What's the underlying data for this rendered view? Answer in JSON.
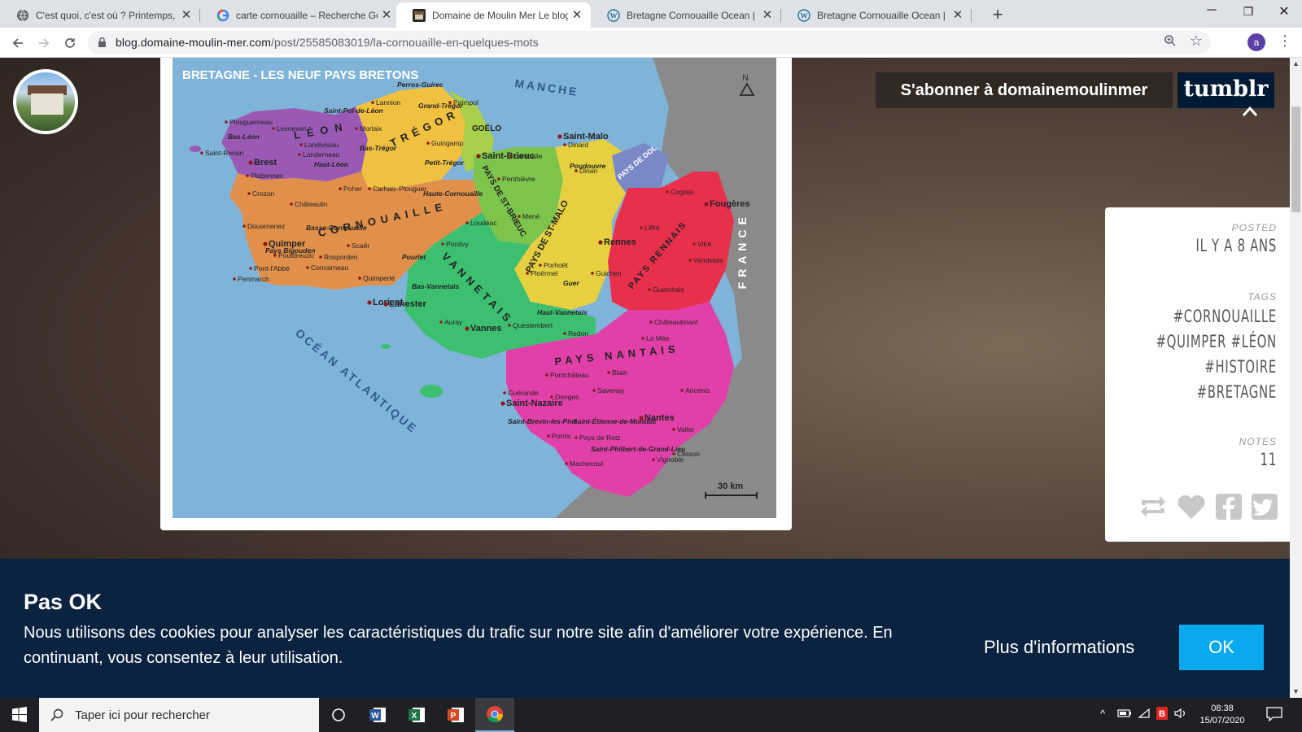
{
  "tabs": [
    {
      "title": "C'est quoi, c'est où ? Printemps, é",
      "active": false
    },
    {
      "title": "carte cornouaille – Recherche Go",
      "active": false
    },
    {
      "title": "Domaine de Moulin Mer Le blog",
      "active": true
    },
    {
      "title": "Bretagne Cornouaille Ocean | De",
      "active": false
    },
    {
      "title": "Bretagne Cornouaille Ocean | De",
      "active": false
    }
  ],
  "tab_close": "✕",
  "new_tab": "+",
  "window": {
    "minimize": "─",
    "restore": "❐",
    "close": "✕"
  },
  "address": {
    "domain": "blog.domaine-moulin-mer.com",
    "path": "/post/25585083019/la-cornouaille-en-quelques-mots"
  },
  "profile_initial": "a",
  "map": {
    "title": "BRETAGNE - LES NEUF PAYS BRETONS",
    "north": "N",
    "scale": "30 km",
    "sea_labels": {
      "manche": "MANCHE",
      "ocean": "OCÉAN ATLANTIQUE",
      "france": "FRANCE"
    },
    "pays": [
      {
        "name": "LÉON",
        "color": "#9b59b6"
      },
      {
        "name": "TRÉGOR",
        "color": "#f0c040"
      },
      {
        "name": "GOËLO",
        "color": "#a8d04a"
      },
      {
        "name": "PAYS DE ST-BRIEUC",
        "color": "#7cc44c"
      },
      {
        "name": "PAYS DE ST-MALO",
        "color": "#e6d040"
      },
      {
        "name": "PAYS DE DOL",
        "color": "#7a88c8"
      },
      {
        "name": "PAYS RENNAIS",
        "color": "#e8304c"
      },
      {
        "name": "CORNOUAILLE",
        "color": "#e0904a"
      },
      {
        "name": "VANNETAIS",
        "color": "#3cc070"
      },
      {
        "name": "PAYS NANTAIS",
        "color": "#e040a8"
      }
    ],
    "towns": [
      "Brest",
      "Quimper",
      "Lorient",
      "Lanester",
      "Vannes",
      "Rennes",
      "Saint-Brieuc",
      "Saint-Malo",
      "Saint-Nazaire",
      "Nantes",
      "Fougères",
      "Crozon",
      "Châteaulin",
      "Douarnenez",
      "Concarneau",
      "Pontivy",
      "Dinard",
      "Morlaix",
      "Lannion",
      "Paimpol",
      "Guingamp",
      "Dinan",
      "Ploërmel",
      "Redon",
      "Vitré",
      "Guérande",
      "Ancenis",
      "Vignoble",
      "Pays de Retz",
      "Plouguerneau",
      "Lesneven",
      "Landerneau",
      "Landivisiau",
      "Saint-Renan",
      "Quimperlé",
      "Pont-l'Abbé",
      "Penmarch",
      "Auray",
      "Questembert",
      "Guichen",
      "Lamballe",
      "Penthièvre",
      "Mené",
      "Porhoët",
      "Coglais",
      "Liffré",
      "Vendelais",
      "Guerchais",
      "Châteaubriant",
      "La Mée",
      "Blain",
      "Pontchâteau",
      "Savenay",
      "Donges",
      "Pornic",
      "Machecoul",
      "Clisson",
      "Vallet",
      "Loudéac",
      "Carhaix-Plouguer",
      "Poher",
      "Scaër",
      "Rosporden",
      "Pouldreuzic",
      "Plabennec"
    ],
    "region_labels": [
      "Bas-Léon",
      "Haut-Léon",
      "Bas-Trégor",
      "Petit-Trégor",
      "Grand-Trégor",
      "Perros-Guirec",
      "Saint-Pol-de-Léon",
      "Haute-Cornouaille",
      "Basse-Cornouaille",
      "Pays Bigouden",
      "Pourlet",
      "Bas-Vannetais",
      "Haut-Vannetais",
      "Poudouvre",
      "Guer",
      "Saint-Brevin-les-Pins",
      "Saint-Étienne-de-Montluc",
      "Saint-Philbert-de-Grand-Lieu"
    ]
  },
  "subscribe_label": "S'abonner à domainemoulinmer",
  "brand": "tumblr",
  "meta": {
    "posted_label": "POSTED",
    "posted_value": "IL Y A 8 ANS",
    "tags_label": "TAGS",
    "tags": [
      "#CORNOUAILLE",
      "#QUIMPER #LÉON",
      "#HISTOIRE",
      "#BRETAGNE"
    ],
    "notes_label": "NOTES",
    "notes_value": "11",
    "actions": [
      "reblog-icon",
      "heart-icon",
      "facebook-icon",
      "twitter-icon"
    ]
  },
  "cookie": {
    "title": "Pas OK",
    "text": "Nous utilisons des cookies pour analyser les caractéristiques du trafic sur notre site afin d'améliorer votre expérience. En continuant, vous consentez à leur utilisation.",
    "more": "Plus d'informations",
    "ok": "OK"
  },
  "taskbar": {
    "search_placeholder": "Taper ici pour rechercher",
    "apps": [
      "task-view-icon",
      "word-icon",
      "excel-icon",
      "powerpoint-icon",
      "chrome-icon"
    ],
    "time": "08:38",
    "date": "15/07/2020"
  },
  "colors": {
    "cookie_bg": "#0b2340",
    "ok_button": "#08a9ee",
    "tumblr_bg": "#001935"
  }
}
